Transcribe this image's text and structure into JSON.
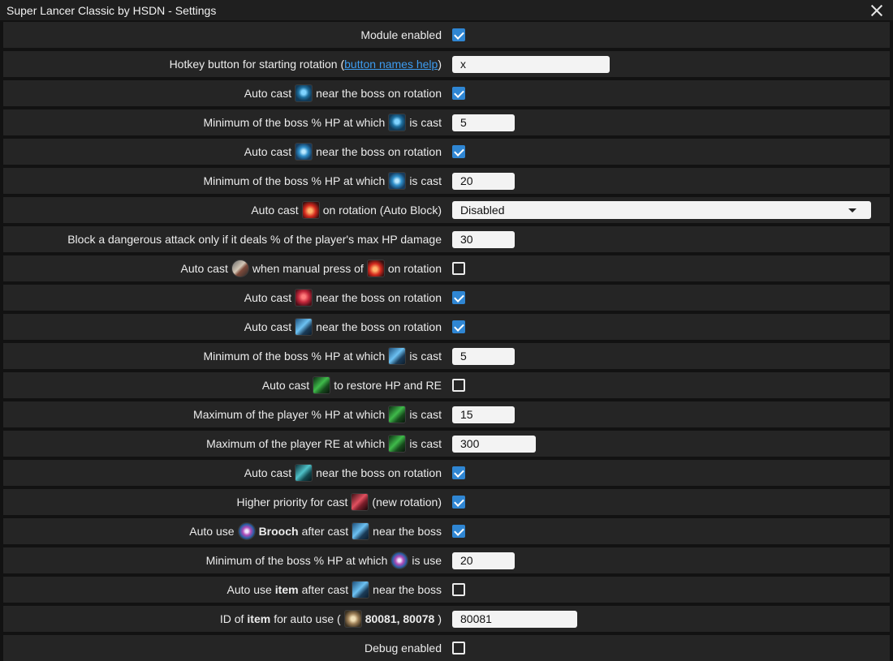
{
  "window": {
    "title": "Super Lancer Classic by HSDN - Settings"
  },
  "rows": {
    "module_enabled": {
      "label": "Module enabled",
      "checked": true
    },
    "hotkey": {
      "label_pre": "Hotkey button for starting rotation (",
      "link": "button names help",
      "label_post": ")",
      "value": "x"
    },
    "r3": {
      "a": "Auto cast",
      "b": "near the boss on rotation",
      "icon": "skill-blue-glow-icon",
      "checked": true
    },
    "r4": {
      "a": "Minimum of the boss % HP at which",
      "b": "is cast",
      "icon": "skill-blue-glow-icon",
      "value": "5"
    },
    "r5": {
      "a": "Auto cast",
      "b": "near the boss on rotation",
      "icon": "skill-blue-figure-icon",
      "checked": true
    },
    "r6": {
      "a": "Minimum of the boss % HP at which",
      "b": "is cast",
      "icon": "skill-blue-figure-icon",
      "value": "20"
    },
    "r7": {
      "a": "Auto cast",
      "b": "on rotation (Auto Block)",
      "icon": "skill-red-fire-icon",
      "select": "Disabled"
    },
    "r8": {
      "a": "Block a dangerous attack only if it deals % of the player's max HP damage",
      "value": "30"
    },
    "r9": {
      "a": "Auto cast",
      "b": "when manual press of",
      "c": "on rotation",
      "icon1": "skill-spear-icon",
      "icon2": "skill-red-fire-icon",
      "checked": false
    },
    "r10": {
      "a": "Auto cast",
      "b": "near the boss on rotation",
      "icon": "skill-red-face-icon",
      "checked": true
    },
    "r11": {
      "a": "Auto cast",
      "b": "near the boss on rotation",
      "icon": "skill-blue-lance-icon",
      "checked": true
    },
    "r12": {
      "a": "Minimum of the boss % HP at which",
      "b": "is cast",
      "icon": "skill-blue-lance-icon",
      "value": "5"
    },
    "r13": {
      "a": "Auto cast",
      "b": "to restore HP and RE",
      "icon": "skill-green-icon",
      "checked": false
    },
    "r14": {
      "a": "Maximum of the player % HP at which",
      "b": "is cast",
      "icon": "skill-green-icon",
      "value": "15"
    },
    "r15": {
      "a": "Maximum of the player RE at which",
      "b": "is cast",
      "icon": "skill-green-icon",
      "value": "300"
    },
    "r16": {
      "a": "Auto cast",
      "b": "near the boss on rotation",
      "icon": "skill-teal-icon",
      "checked": true
    },
    "r17": {
      "a": "Higher priority for cast",
      "b": "(new rotation)",
      "icon": "skill-red-spear-icon",
      "checked": true
    },
    "r18": {
      "a": "Auto use",
      "bold": "Brooch",
      "b": "after cast",
      "c": "near the boss",
      "icon1": "brooch-icon",
      "icon2": "skill-blue-lance-icon",
      "checked": true
    },
    "r19": {
      "a": "Minimum of the boss % HP at which",
      "b": "is use",
      "icon": "brooch-icon",
      "value": "20"
    },
    "r20": {
      "a": "Auto use",
      "bold": "item",
      "b": "after cast",
      "c": "near the boss",
      "icon": "skill-blue-lance-icon",
      "checked": false
    },
    "r21": {
      "a": "ID of",
      "bold": "item",
      "b": "for auto use (",
      "ids": "80081, 80078",
      "c": ")",
      "icon": "item-icon",
      "value": "80081"
    },
    "r22": {
      "label": "Debug enabled",
      "checked": false
    }
  },
  "colors": {
    "accent": "#2f86d3",
    "link": "#3d9cf0",
    "row_bg": "#252525",
    "bg": "#121212"
  }
}
